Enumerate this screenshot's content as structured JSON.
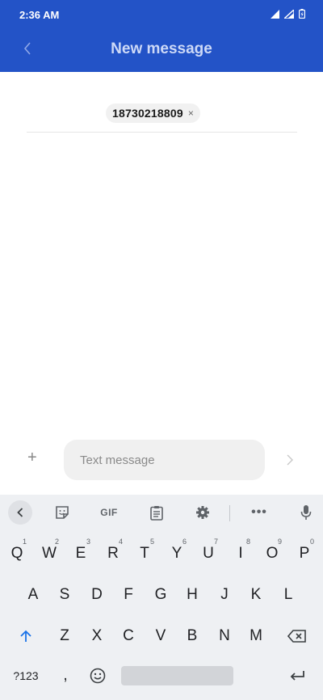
{
  "status_bar": {
    "time": "2:36 AM"
  },
  "header": {
    "title": "New message"
  },
  "recipient": {
    "number": "18730218809",
    "remove_glyph": "×"
  },
  "compose": {
    "add_glyph": "+",
    "placeholder": "Text message"
  },
  "keyboard": {
    "toolbar": {
      "gif_label": "GIF",
      "more_label": "•••"
    },
    "row1": [
      {
        "label": "Q",
        "hint": "1"
      },
      {
        "label": "W",
        "hint": "2"
      },
      {
        "label": "E",
        "hint": "3"
      },
      {
        "label": "R",
        "hint": "4"
      },
      {
        "label": "T",
        "hint": "5"
      },
      {
        "label": "Y",
        "hint": "6"
      },
      {
        "label": "U",
        "hint": "7"
      },
      {
        "label": "I",
        "hint": "8"
      },
      {
        "label": "O",
        "hint": "9"
      },
      {
        "label": "P",
        "hint": "0"
      }
    ],
    "row2": [
      "A",
      "S",
      "D",
      "F",
      "G",
      "H",
      "J",
      "K",
      "L"
    ],
    "row3": [
      "Z",
      "X",
      "C",
      "V",
      "B",
      "N",
      "M"
    ],
    "symbols_label": "?123",
    "comma_label": ","
  },
  "colors": {
    "header_bg": "#2353c7",
    "keyboard_bg": "#eef0f3",
    "shift_blue": "#1a73e8"
  }
}
